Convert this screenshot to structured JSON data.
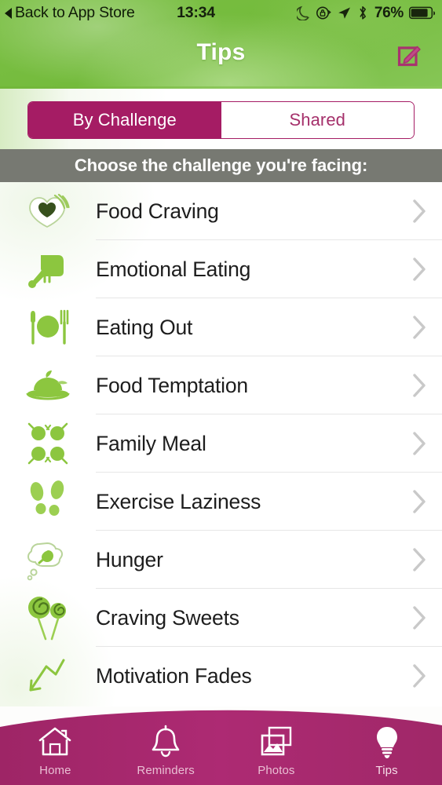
{
  "status_bar": {
    "back_label": "Back to App Store",
    "time": "13:34",
    "battery_percent": "76%",
    "icons": [
      "moon-icon",
      "rotation-lock-icon",
      "location-arrow-icon",
      "bluetooth-icon",
      "battery-icon"
    ]
  },
  "nav": {
    "title": "Tips",
    "compose_icon": "compose-edit-icon"
  },
  "segmented_control": {
    "options": [
      {
        "label": "By Challenge",
        "selected": true
      },
      {
        "label": "Shared",
        "selected": false
      }
    ]
  },
  "section_header": {
    "text": "Choose the challenge you're facing:"
  },
  "list": {
    "items": [
      {
        "label": "Food Craving",
        "icon": "apple-heart-icon"
      },
      {
        "label": "Emotional Eating",
        "icon": "hand-mixer-icon"
      },
      {
        "label": "Eating Out",
        "icon": "plate-cutlery-icon"
      },
      {
        "label": "Food Temptation",
        "icon": "roast-turkey-icon"
      },
      {
        "label": "Family Meal",
        "icon": "four-plates-icon"
      },
      {
        "label": "Exercise Laziness",
        "icon": "footprints-icon"
      },
      {
        "label": "Hunger",
        "icon": "thought-bubble-food-icon"
      },
      {
        "label": "Craving Sweets",
        "icon": "lollipops-icon"
      },
      {
        "label": "Motivation Fades",
        "icon": "declining-arrow-icon"
      }
    ],
    "chevron_icon": "chevron-right-icon"
  },
  "tab_bar": {
    "tabs": [
      {
        "label": "Home",
        "icon": "house-icon",
        "active": false
      },
      {
        "label": "Reminders",
        "icon": "bell-icon",
        "active": false
      },
      {
        "label": "Photos",
        "icon": "photos-icon",
        "active": false
      },
      {
        "label": "Tips",
        "icon": "lightbulb-icon",
        "active": true
      }
    ]
  },
  "colors": {
    "brand_magenta": "#a51c64",
    "brand_green": "#7cc046",
    "section_gray": "#777972",
    "icon_green": "#8cc63f",
    "text_dark": "#1d1d1d",
    "chevron_gray": "#c9c9c9"
  }
}
